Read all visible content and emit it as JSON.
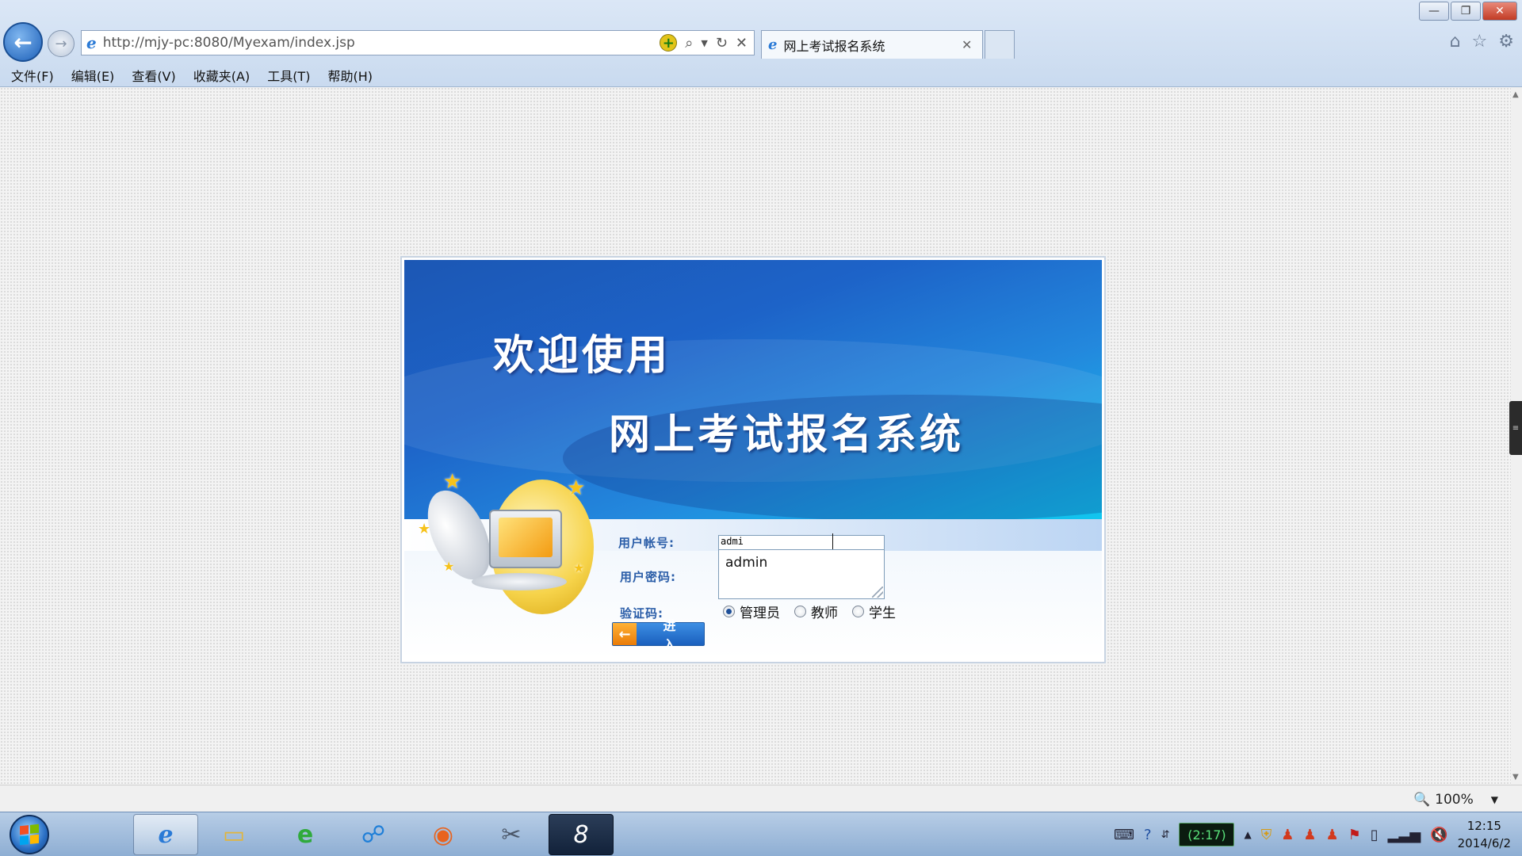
{
  "window": {
    "minimize": "—",
    "restore": "❐",
    "close": "✕"
  },
  "nav": {
    "back": "←",
    "forward": "→"
  },
  "address": {
    "url": "http://mjy-pc:8080/Myexam/index.jsp",
    "icon": "ie-icon"
  },
  "tab": {
    "title": "网上考试报名系统",
    "close": "✕"
  },
  "right_icons": [
    "home-icon",
    "star-icon",
    "gear-icon"
  ],
  "menu": [
    "文件(F)",
    "编辑(E)",
    "查看(V)",
    "收藏夹(A)",
    "工具(T)",
    "帮助(H)"
  ],
  "banner": {
    "line1": "欢迎使用",
    "line2": "网上考试报名系统"
  },
  "form": {
    "user_label": "用户帐号:",
    "password_label": "用户密码:",
    "captcha_label": "验证码:",
    "user_value": "admi",
    "suggestion": "admin",
    "roles": [
      {
        "label": "管理员",
        "checked": true
      },
      {
        "label": "教师",
        "checked": false
      },
      {
        "label": "学生",
        "checked": false
      }
    ],
    "enter_label": "进 入"
  },
  "status": {
    "zoom": "100%"
  },
  "taskbar": {
    "battery": "(2:17)",
    "time": "12:15",
    "date": "2014/6/2"
  }
}
